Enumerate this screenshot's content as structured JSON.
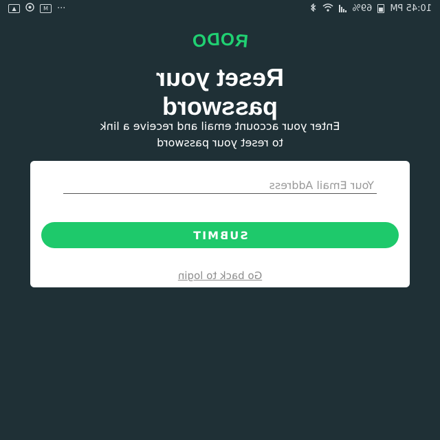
{
  "status_bar": {
    "time": "10:45 PM",
    "battery": "69%",
    "overflow": "···",
    "icons": [
      "battery-icon",
      "signal-icon",
      "wifi-icon",
      "bluetooth-icon",
      "mail-icon",
      "media-icon",
      "image-icon"
    ]
  },
  "logo": {
    "letters": [
      "R",
      "O",
      "D",
      "O"
    ],
    "color": "#20d072"
  },
  "title": {
    "line1": "Reset your",
    "line2": "password"
  },
  "subtitle": {
    "line1": "Enter your account email and receive a link",
    "line2": "to reset your password"
  },
  "form": {
    "email_value": "",
    "email_placeholder": "Your Email Address",
    "submit_label": "SUBMIT",
    "back_link": "Go back to login"
  },
  "colors": {
    "background": "#1f3036",
    "accent": "#1ec96b",
    "card": "#ffffff"
  }
}
